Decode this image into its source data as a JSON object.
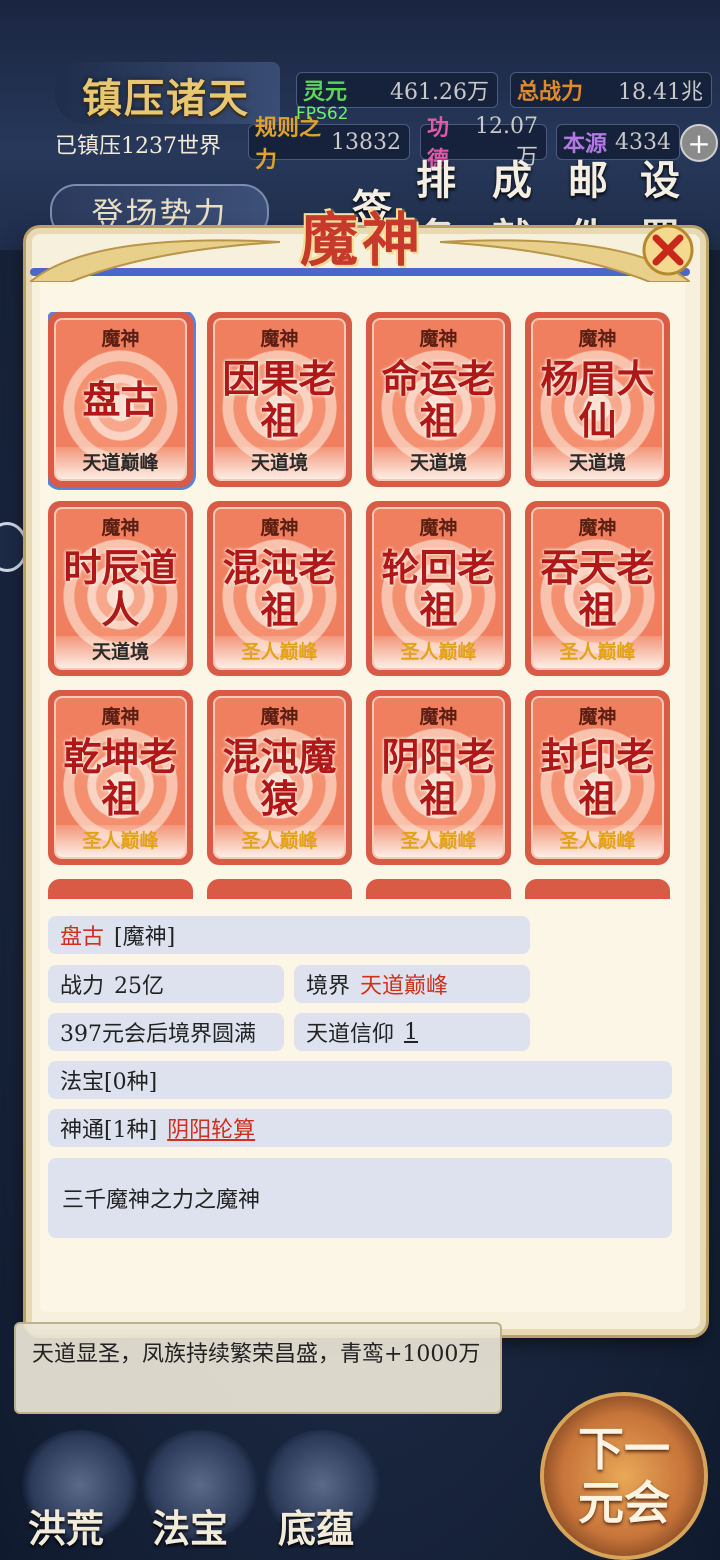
{
  "header": {
    "title": "镇压诸天",
    "worlds_text": "已镇压1237世界",
    "fps": "FPS62",
    "stats": [
      {
        "label": "灵元",
        "value": "461.26万",
        "label_color": "#5fd35a"
      },
      {
        "label": "总战力",
        "value": "18.41兆",
        "label_color": "#e08a2a"
      },
      {
        "label": "规则之力",
        "value": "13832",
        "label_color": "#e0a32a"
      },
      {
        "label": "功德",
        "value": "12.07万",
        "label_color": "#e05aa8"
      },
      {
        "label": "本源",
        "value": "4334",
        "label_color": "#b07ae0"
      }
    ],
    "plus": "+",
    "faction_button": "登场势力",
    "menu": [
      "签",
      "排名",
      "成就",
      "邮件",
      "设置"
    ]
  },
  "dialog": {
    "title": "魔神",
    "close": "✕",
    "cards": [
      {
        "category": "魔神",
        "name": "盘古",
        "rank": "天道巅峰",
        "rank_color": "#2a2a2a",
        "selected": true
      },
      {
        "category": "魔神",
        "name": "因果老祖",
        "rank": "天道境",
        "rank_color": "#2a2a2a"
      },
      {
        "category": "魔神",
        "name": "命运老祖",
        "rank": "天道境",
        "rank_color": "#2a2a2a"
      },
      {
        "category": "魔神",
        "name": "杨眉大仙",
        "rank": "天道境",
        "rank_color": "#2a2a2a"
      },
      {
        "category": "魔神",
        "name": "时辰道人",
        "rank": "天道境",
        "rank_color": "#2a2a2a"
      },
      {
        "category": "魔神",
        "name": "混沌老祖",
        "rank": "圣人巅峰",
        "rank_color": "#e2a31a"
      },
      {
        "category": "魔神",
        "name": "轮回老祖",
        "rank": "圣人巅峰",
        "rank_color": "#e2a31a"
      },
      {
        "category": "魔神",
        "name": "吞天老祖",
        "rank": "圣人巅峰",
        "rank_color": "#e2a31a"
      },
      {
        "category": "魔神",
        "name": "乾坤老祖",
        "rank": "圣人巅峰",
        "rank_color": "#e2a31a"
      },
      {
        "category": "魔神",
        "name": "混沌魔猿",
        "rank": "圣人巅峰",
        "rank_color": "#e2a31a"
      },
      {
        "category": "魔神",
        "name": "阴阳老祖",
        "rank": "圣人巅峰",
        "rank_color": "#e2a31a"
      },
      {
        "category": "魔神",
        "name": "封印老祖",
        "rank": "圣人巅峰",
        "rank_color": "#e2a31a"
      }
    ],
    "detail": {
      "name": "盘古",
      "category_tag": "[魔神]",
      "power_label": "战力",
      "power_value": "25亿",
      "realm_label": "境界",
      "realm_value": "天道巅峰",
      "perfect_text": "397元会后境界圆满",
      "faith_label": "天道信仰",
      "faith_value": "1",
      "treasure_text": "法宝[0种]",
      "skill_label": "神通[1种]",
      "skill_value": "阴阳轮算",
      "description": "三千魔神之力之魔神"
    }
  },
  "log": {
    "text": "天道显圣，凤族持续繁荣昌盛，青鸾+1000万"
  },
  "bottom_nav": [
    "洪荒",
    "法宝",
    "底蕴"
  ],
  "next_button": "下一元会"
}
